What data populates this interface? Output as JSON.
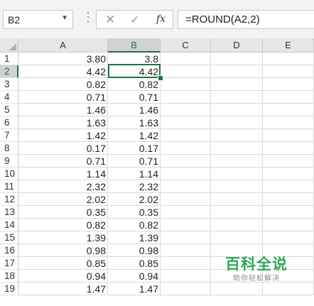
{
  "formula_bar": {
    "name_box": "B2",
    "formula": "=ROUND(A2,2)",
    "fx_label": "fx"
  },
  "columns": [
    "A",
    "B",
    "C",
    "D",
    "E"
  ],
  "selected_column": "B",
  "selected_row": "2",
  "rows": [
    {
      "num": "1",
      "a": "3.80",
      "b": "3.8"
    },
    {
      "num": "2",
      "a": "4.42",
      "b": "4.42"
    },
    {
      "num": "3",
      "a": "0.82",
      "b": "0.82"
    },
    {
      "num": "4",
      "a": "0.71",
      "b": "0.71"
    },
    {
      "num": "5",
      "a": "1.46",
      "b": "1.46"
    },
    {
      "num": "6",
      "a": "1.63",
      "b": "1.63"
    },
    {
      "num": "7",
      "a": "1.42",
      "b": "1.42"
    },
    {
      "num": "8",
      "a": "0.17",
      "b": "0.17"
    },
    {
      "num": "9",
      "a": "0.71",
      "b": "0.71"
    },
    {
      "num": "10",
      "a": "1.14",
      "b": "1.14"
    },
    {
      "num": "11",
      "a": "2.32",
      "b": "2.32"
    },
    {
      "num": "12",
      "a": "2.02",
      "b": "2.02"
    },
    {
      "num": "13",
      "a": "0.35",
      "b": "0.35"
    },
    {
      "num": "14",
      "a": "0.82",
      "b": "0.82"
    },
    {
      "num": "15",
      "a": "1.39",
      "b": "1.39"
    },
    {
      "num": "16",
      "a": "0.98",
      "b": "0.98"
    },
    {
      "num": "17",
      "a": "0.85",
      "b": "0.85"
    },
    {
      "num": "18",
      "a": "0.94",
      "b": "0.94"
    },
    {
      "num": "19",
      "a": "1.47",
      "b": "1.47"
    }
  ],
  "watermark": {
    "title": "百科全说",
    "subtitle": "助你轻松解决"
  },
  "colors": {
    "accent": "#217346",
    "watermark": "#2ea85a"
  }
}
